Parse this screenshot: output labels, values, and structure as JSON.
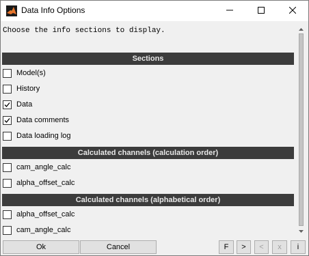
{
  "window": {
    "title": "Data Info Options"
  },
  "titlebar_controls": {
    "minimize_icon": "minimize-icon",
    "maximize_icon": "maximize-icon",
    "close_icon": "close-icon"
  },
  "prompt": "Choose the info sections to display.",
  "groups": [
    {
      "header": "Sections",
      "items": [
        {
          "label": "Model(s)",
          "checked": false
        },
        {
          "label": "History",
          "checked": false
        },
        {
          "label": "Data",
          "checked": true
        },
        {
          "label": "Data comments",
          "checked": true
        },
        {
          "label": "Data loading log",
          "checked": false
        }
      ]
    },
    {
      "header": "Calculated channels (calculation order)",
      "items": [
        {
          "label": "cam_angle_calc",
          "checked": false
        },
        {
          "label": "alpha_offset_calc",
          "checked": false
        }
      ]
    },
    {
      "header": "Calculated channels (alphabetical order)",
      "items": [
        {
          "label": "alpha_offset_calc",
          "checked": false
        },
        {
          "label": "cam_angle_calc",
          "checked": false
        }
      ]
    }
  ],
  "footer": {
    "ok_label": "Ok",
    "cancel_label": "Cancel",
    "first_label": "F",
    "next_label": ">",
    "prev_label": "<",
    "x_label": "x",
    "info_label": "i"
  },
  "colors": {
    "section_header_bg": "#3c3c3c",
    "section_header_text": "#e8e8e8",
    "window_bg": "#f0f0f0"
  }
}
